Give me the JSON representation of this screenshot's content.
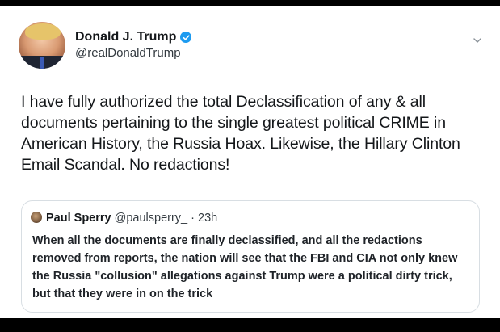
{
  "tweet": {
    "author": {
      "display_name": "Donald J. Trump",
      "handle": "@realDonaldTrump",
      "verified": true
    },
    "text": "I have fully authorized the total Declassification of any & all documents pertaining to the single greatest political CRIME in American History, the Russia Hoax. Likewise, the Hillary Clinton Email Scandal. No redactions!",
    "menu_icon": "chevron-down-icon"
  },
  "quoted_tweet": {
    "author": {
      "display_name": "Paul Sperry",
      "handle": "@paulsperry_"
    },
    "separator": " · ",
    "time": "23h",
    "text": "When all the documents are finally declassified, and all the redactions removed from reports, the nation will see that the FBI and CIA not only knew the Russia \"collusion\" allegations against Trump were a political dirty trick, but that they were in on the trick"
  },
  "colors": {
    "verified_badge": "#1d9bf0",
    "text_primary": "#14171a",
    "border": "#d8dee3"
  }
}
